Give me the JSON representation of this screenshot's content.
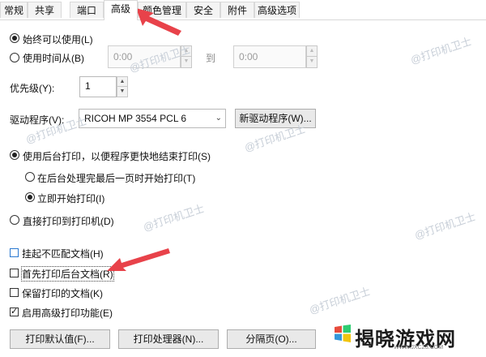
{
  "tabs": [
    "常规",
    "共享",
    "端口",
    "高级",
    "颜色管理",
    "安全",
    "附件",
    "高级选项"
  ],
  "availability": {
    "always_label": "始终可以使用(L)",
    "from_label": "使用时间从(B)",
    "from_value": "0:00",
    "to_label": "到",
    "to_value": "0:00"
  },
  "priority": {
    "label": "优先级(Y):",
    "value": "1"
  },
  "driver": {
    "label": "驱动程序(V):",
    "selected": "RICOH MP 3554 PCL 6",
    "new_driver_button": "新驱动程序(W)..."
  },
  "spool": {
    "spool_label": "使用后台打印，以便程序更快地结束打印(S)",
    "after_last_page_label": "在后台处理完最后一页时开始打印(T)",
    "immediately_label": "立即开始打印(I)",
    "direct_label": "直接打印到打印机(D)"
  },
  "options": {
    "hold_mismatched": "挂起不匹配文档(H)",
    "print_spooled_first": "首先打印后台文档(R)",
    "keep_printed": "保留打印的文档(K)",
    "enable_advanced": "启用高级打印功能(E)"
  },
  "buttons": {
    "defaults": "打印默认值(F)...",
    "processor": "打印处理器(N)...",
    "separator": "分隔页(O)..."
  },
  "watermark": "@打印机卫士",
  "branding": {
    "text": "揭晓游戏网",
    "url": "WWW.JXCZ3.COM"
  },
  "colors": {
    "accent_arrow": "#e8424a",
    "focus_blue": "#2a78d0"
  }
}
